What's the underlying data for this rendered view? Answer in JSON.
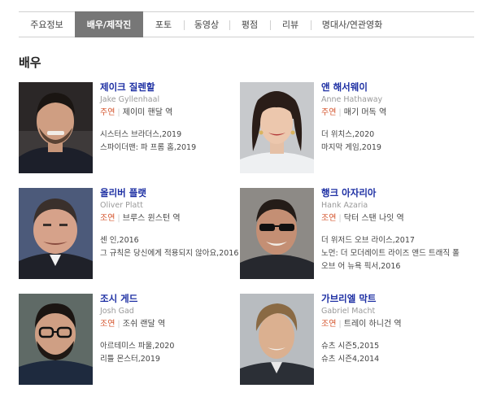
{
  "tabs": [
    {
      "label": "주요정보",
      "active": false
    },
    {
      "label": "배우/제작진",
      "active": true
    },
    {
      "label": "포토",
      "active": false
    },
    {
      "label": "동영상",
      "active": false
    },
    {
      "label": "평점",
      "active": false
    },
    {
      "label": "리뷰",
      "active": false
    },
    {
      "label": "명대사/연관영화",
      "active": false
    }
  ],
  "section_title": "배우",
  "actors": [
    {
      "name": "제이크 질렌할",
      "eng_name": "Jake Gyllenhaal",
      "role_type": "주연",
      "role": "제이미 핸달 역",
      "works": [
        "시스터스 브라더스,2019",
        "스파이더맨: 파 프롬 홈,2019"
      ]
    },
    {
      "name": "앤 해서웨이",
      "eng_name": "Anne Hathaway",
      "role_type": "주연",
      "role": "매기 머독 역",
      "works": [
        "더 위치스,2020",
        "마지막 게임,2019"
      ]
    },
    {
      "name": "올리버 플랫",
      "eng_name": "Oliver Platt",
      "role_type": "조연",
      "role": "브루스 윈스턴 역",
      "works": [
        "센 인,2016",
        "그 규칙은 당신에게 적용되지 않아요,2016"
      ]
    },
    {
      "name": "행크 아자리아",
      "eng_name": "Hank Azaria",
      "role_type": "조연",
      "role": "닥터 스탠 나잇 역",
      "works": [
        "더 위저드 오브 라이스,2017",
        "노먼: 더 모더레이트 라이즈 앤드 트래직 폴 오브 어 뉴욕 픽서,2016"
      ]
    },
    {
      "name": "조시 게드",
      "eng_name": "Josh Gad",
      "role_type": "조연",
      "role": "조쉬 랜달 역",
      "works": [
        "아르테미스 파울,2020",
        "리틀 몬스터,2019"
      ]
    },
    {
      "name": "가브리엘 막트",
      "eng_name": "Gabriel Macht",
      "role_type": "조연",
      "role": "트레이 하니건 역",
      "works": [
        "슈츠 시즌5,2015",
        "슈츠 시즌4,2014"
      ]
    }
  ],
  "colors": {
    "active_tab_bg": "#777777",
    "name_link": "#1d2fa3",
    "role_type": "#d4542c"
  }
}
